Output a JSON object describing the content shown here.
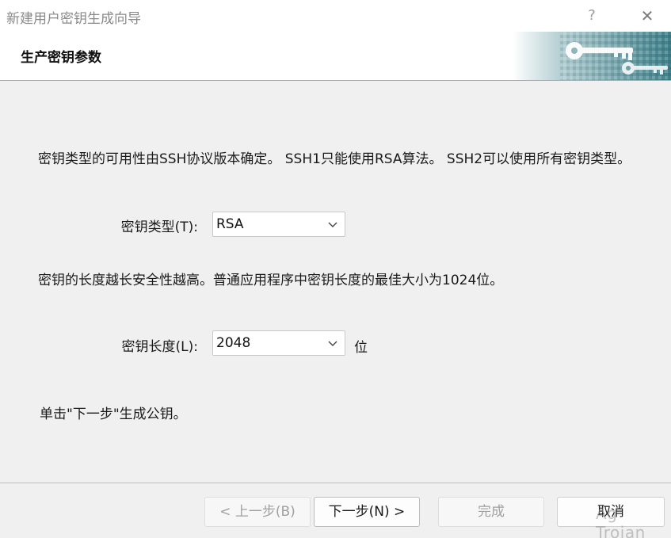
{
  "window": {
    "title": "新建用户密钥生成向导",
    "help_glyph": "?",
    "close_glyph": "✕"
  },
  "header": {
    "heading": "生产密钥参数"
  },
  "body": {
    "intro": "密钥类型的可用性由SSH协议版本确定。 SSH1只能使用RSA算法。 SSH2可以使用所有密钥类型。",
    "key_type_label": "密钥类型(T):",
    "key_type_value": "RSA",
    "length_info": "密钥的长度越长安全性越高。普通应用程序中密钥长度的最佳大小为1024位。",
    "key_length_label": "密钥长度(L):",
    "key_length_value": "2048",
    "key_length_unit": "位",
    "instruction": "单击\"下一步\"生成公钥。"
  },
  "footer": {
    "back_label": "< 上一步(B)",
    "next_label": "下一步(N) >",
    "finish_label": "完成",
    "cancel_label": "取消"
  },
  "watermark": "Ag Trojan",
  "colors": {
    "banner_teal": "#4a8a94",
    "window_bg": "#f0f0f0"
  }
}
